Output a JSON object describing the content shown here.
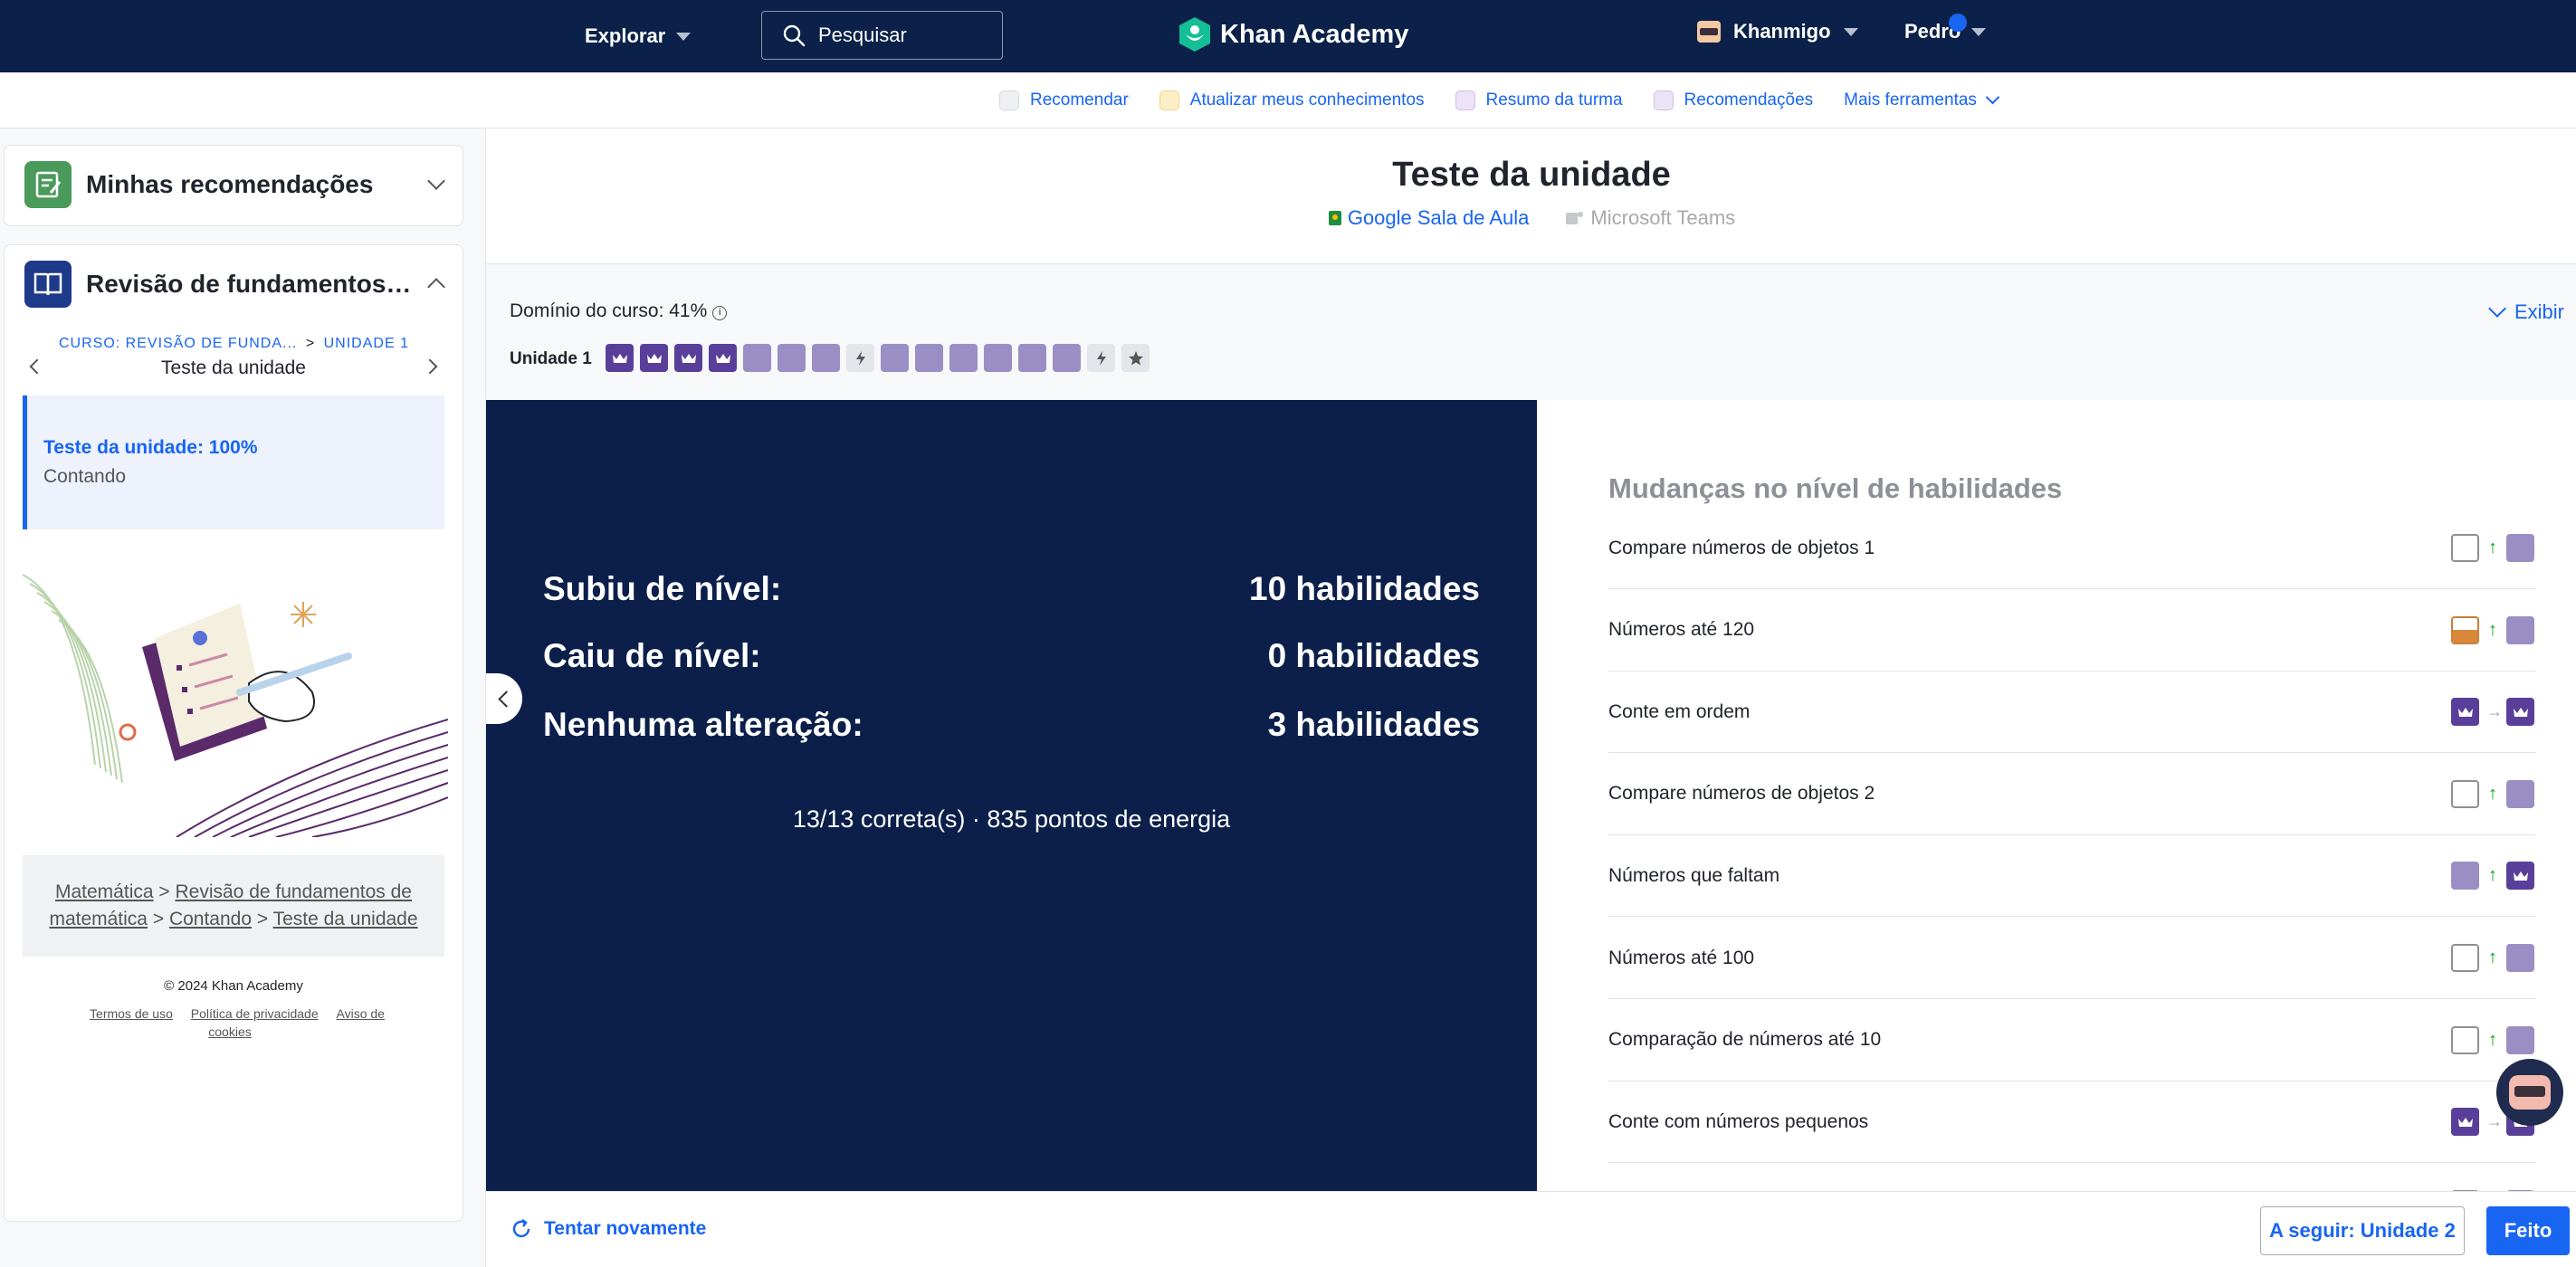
{
  "topbar": {
    "explore": "Explorar",
    "search_placeholder": "Pesquisar",
    "logo": "Khan Academy",
    "khanmigo": "Khanmigo",
    "user": "Pedro"
  },
  "tools": [
    {
      "label": "Recomendar",
      "icon": "document-icon"
    },
    {
      "label": "Atualizar meus conhecimentos",
      "icon": "brain-icon"
    },
    {
      "label": "Resumo da turma",
      "icon": "camera-icon"
    },
    {
      "label": "Recomendações",
      "icon": "lightbulb-icon"
    },
    {
      "label": "Mais ferramentas",
      "icon": "chevron-down-icon"
    }
  ],
  "sidebar": {
    "recs_title": "Minhas recomendações",
    "course_title": "Revisão de fundamentos de ...",
    "crumb_course": "CURSO: REVISÃO DE FUNDA...",
    "crumb_sep": ">",
    "crumb_unit": "UNIDADE 1",
    "current": "Teste da unidade",
    "active_item_title": "Teste da unidade: 100%",
    "active_item_sub": "Contando",
    "breadcrumbs": [
      "Matemática",
      "Revisão de fundamentos de matemática",
      "Contando",
      "Teste da unidade"
    ],
    "copyright": "© 2024 Khan Academy",
    "footer_links": [
      "Termos de uso",
      "Política de privacidade",
      "Aviso de cookies"
    ]
  },
  "main": {
    "title": "Teste da unidade",
    "google": "Google Sala de Aula",
    "teams": "Microsoft Teams",
    "mastery_label": "Domínio do curso: 41%",
    "unit_label": "Unidade 1",
    "unit_chips": [
      "mastered",
      "mastered",
      "mastered",
      "mastered",
      "proficient",
      "proficient",
      "proficient",
      "quiz",
      "proficient",
      "proficient",
      "proficient",
      "proficient",
      "proficient",
      "proficient",
      "quiz",
      "unit-test"
    ],
    "expand_label": "Exibir"
  },
  "results": {
    "rows": [
      {
        "label": "Subiu de nível:",
        "value": "10 habilidades"
      },
      {
        "label": "Caiu de nível:",
        "value": "0 habilidades"
      },
      {
        "label": "Nenhuma alteração:",
        "value": "3 habilidades"
      }
    ],
    "summary": "13/13 correta(s) · 835 pontos de energia"
  },
  "skills": {
    "title": "Mudanças no nível de habilidades",
    "items": [
      {
        "name": "Compare números de objetos 1",
        "from": "empty",
        "change": "up",
        "to": "proficient"
      },
      {
        "name": "Números até 120",
        "from": "familiar",
        "change": "up",
        "to": "proficient"
      },
      {
        "name": "Conte em ordem",
        "from": "mastered",
        "change": "same",
        "to": "mastered"
      },
      {
        "name": "Compare números de objetos 2",
        "from": "empty",
        "change": "up",
        "to": "proficient"
      },
      {
        "name": "Números que faltam",
        "from": "proficient",
        "change": "up",
        "to": "mastered"
      },
      {
        "name": "Números até 100",
        "from": "empty",
        "change": "up",
        "to": "proficient"
      },
      {
        "name": "Comparação de números até 10",
        "from": "empty",
        "change": "up",
        "to": "proficient"
      },
      {
        "name": "Conte com números pequenos",
        "from": "mastered",
        "change": "same",
        "to": "mastered"
      },
      {
        "name": "",
        "from": "empty",
        "change": "up",
        "to": "proficient"
      }
    ]
  },
  "bottom": {
    "retry": "Tentar novamente",
    "next": "A seguir: Unidade 2",
    "done": "Feito"
  }
}
